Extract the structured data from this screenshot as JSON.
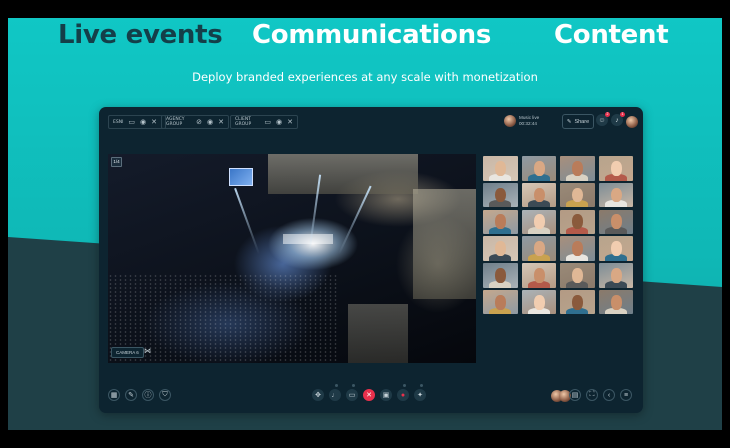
{
  "hero": {
    "tab_live": "Live events",
    "tab_comm": "Communications",
    "tab_content": "Content",
    "subtitle": "Deploy branded experiences at any scale with monetization"
  },
  "colors": {
    "teal": "#10c7c5",
    "dark_band": "#1f4047",
    "app_bg": "#0d2430",
    "end_call": "#e8304c",
    "dark_headline": "#143f49"
  },
  "app": {
    "groups": [
      {
        "label": "ESNI",
        "icons": [
          "camera-icon",
          "mic-icon",
          "close-icon"
        ]
      },
      {
        "label": "AGENCY GROUP",
        "icons": [
          "camera-off-icon",
          "mic-icon",
          "close-icon"
        ]
      },
      {
        "label": "CLIENT GROUP",
        "icons": [
          "camera-icon",
          "mic-icon",
          "close-icon"
        ]
      }
    ],
    "music_line1": "Music live",
    "music_line2": "00:32:44",
    "share_label": "Share",
    "notif_count_1": "2",
    "notif_count_2": "1",
    "video_badge": "1/4",
    "camera_label": "CAMERA 6",
    "participant_count": 24
  }
}
